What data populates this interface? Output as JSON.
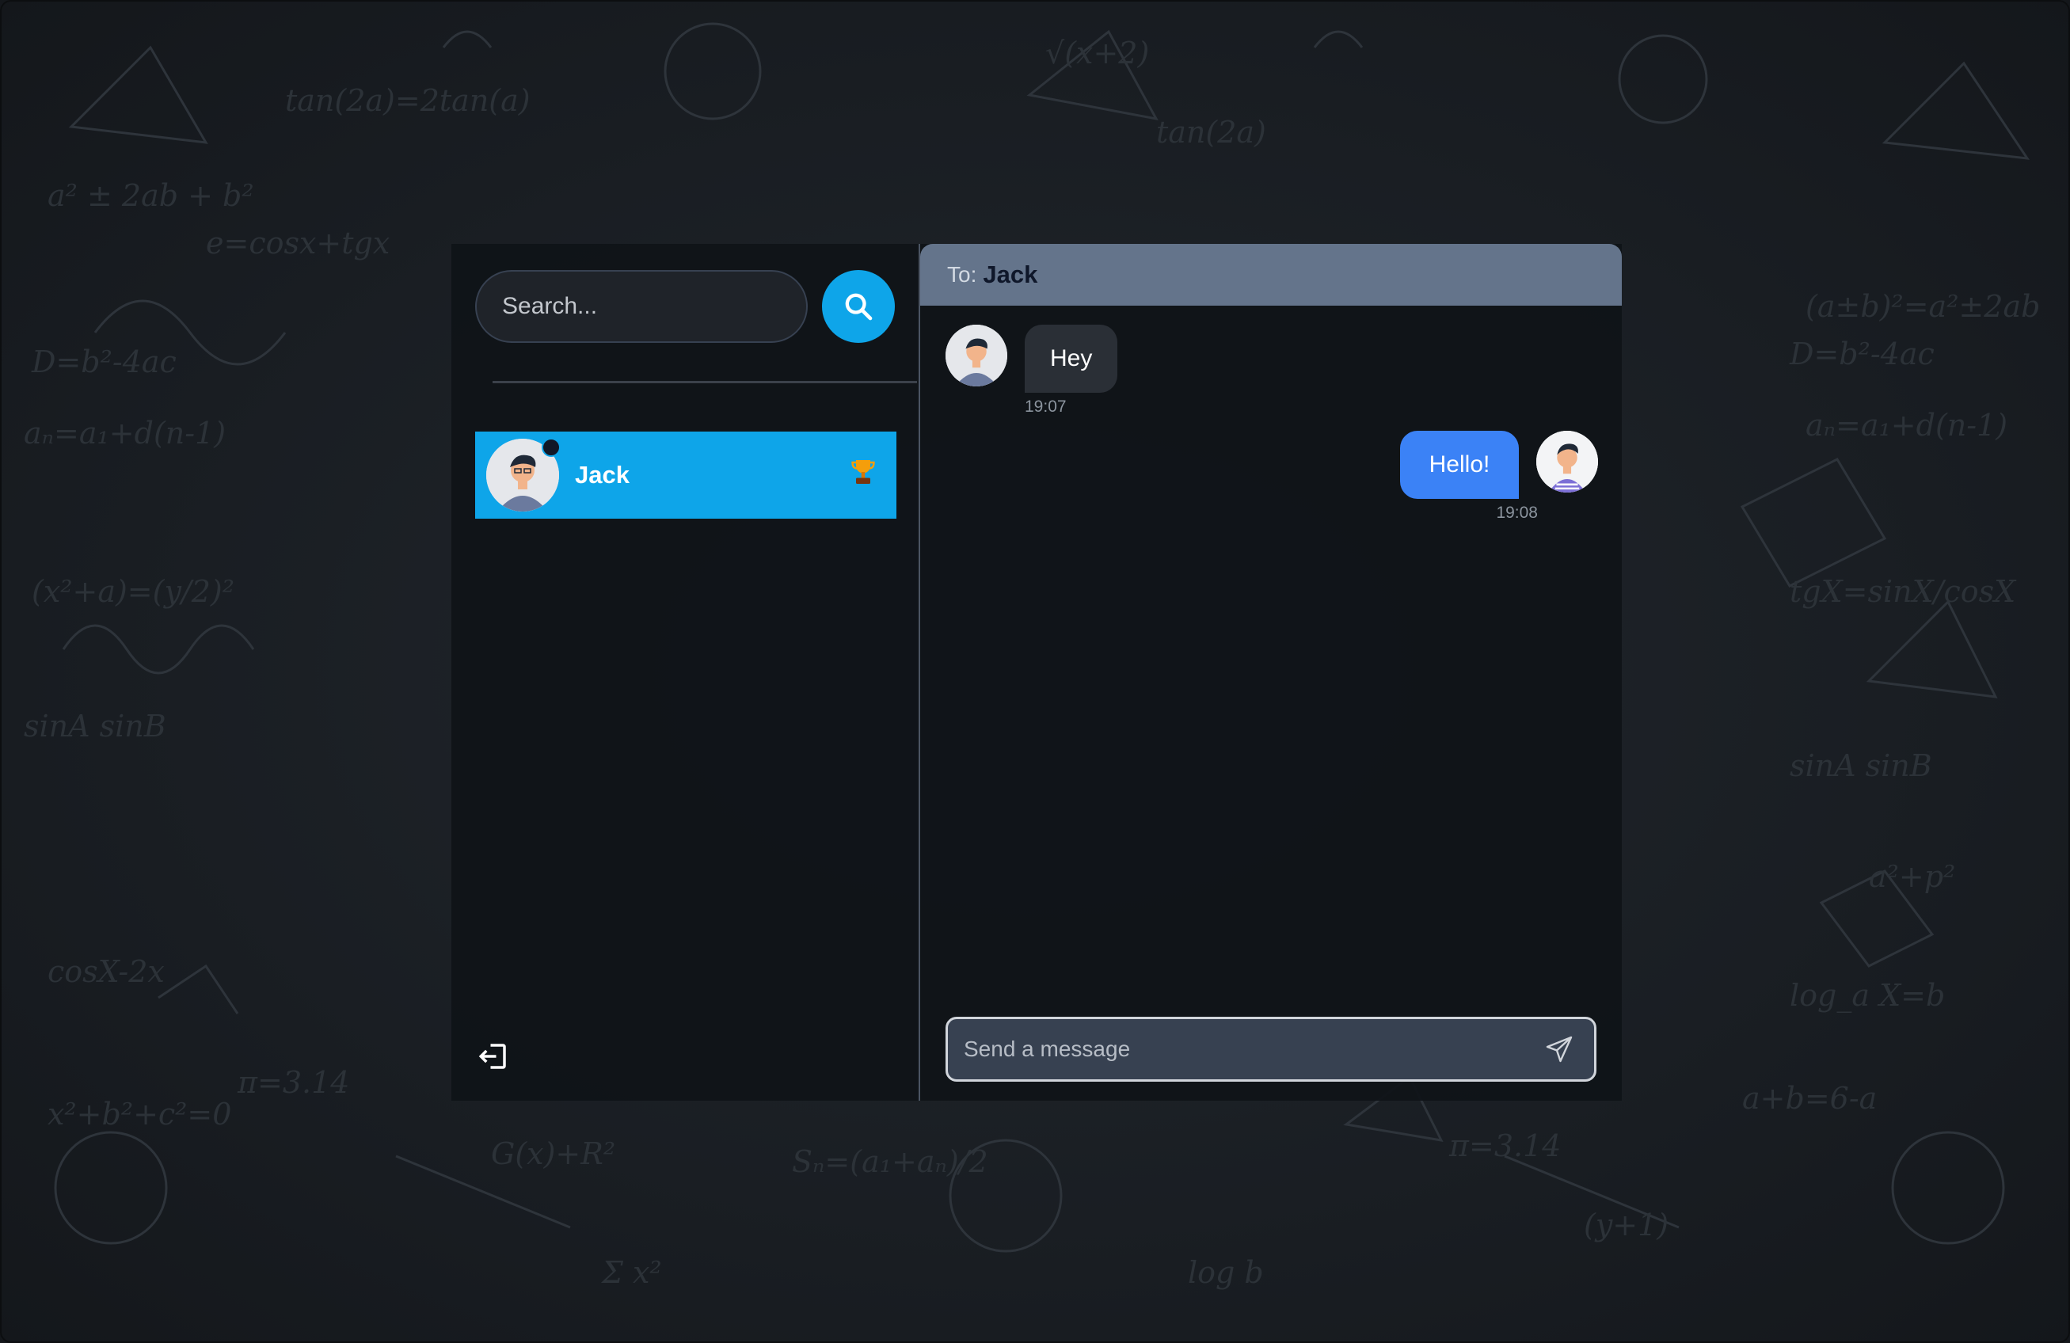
{
  "app": {
    "background": "math-chalkboard"
  },
  "sidebar": {
    "search": {
      "placeholder": "Search...",
      "button_icon": "search-icon"
    },
    "contacts": [
      {
        "name": "Jack",
        "online": true,
        "badge_icon": "trophy-icon",
        "selected": true
      }
    ],
    "logout_icon": "logout-icon"
  },
  "chat": {
    "header": {
      "to_label": "To:",
      "recipient": "Jack"
    },
    "messages": [
      {
        "direction": "incoming",
        "text": "Hey",
        "time": "19:07"
      },
      {
        "direction": "outgoing",
        "text": "Hello!",
        "time": "19:08"
      }
    ],
    "composer": {
      "placeholder": "Send a message",
      "send_icon": "send-icon"
    }
  },
  "colors": {
    "accent": "#0ea5e9",
    "outgoing_bubble": "#3b82f6",
    "incoming_bubble": "#2a2f36",
    "header": "#64748b"
  }
}
